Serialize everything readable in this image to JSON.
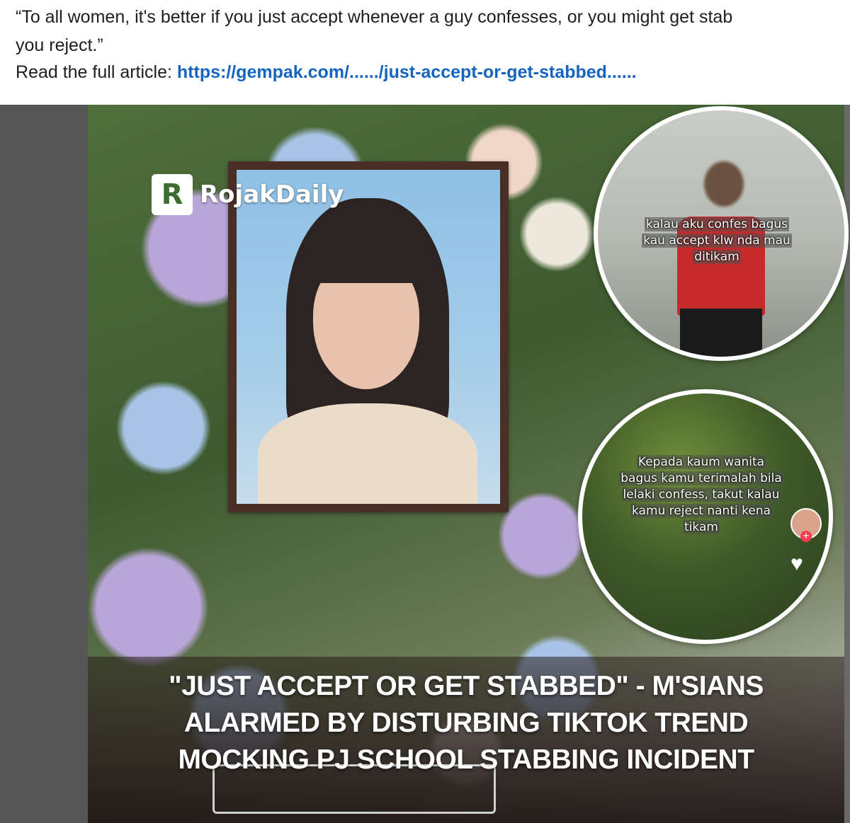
{
  "post": {
    "quote_line_1": "“To all women, it's better if you just accept whenever a guy confesses, or you might get stab",
    "quote_line_2": "you reject.”",
    "read_label": "Read the full article: ",
    "link_text": "https://gempak.com/....../just-accept-or-get-stabbed......"
  },
  "image": {
    "logo_mark": "R",
    "logo_text": "RojakDaily",
    "bubble_top_caption": [
      "kalau aku confes bagus",
      "kau accept klw nda mau",
      "ditikam"
    ],
    "bubble_bottom_caption": [
      "Kepada kaum wanita",
      "bagus kamu terimalah bila",
      "lelaki confess, takut kalau",
      "kamu reject nanti kena",
      "tikam"
    ],
    "avatar_plus": "+",
    "headline_lines": [
      "\"JUST ACCEPT OR GET STABBED\" - M'SIANS",
      "ALARMED BY DISTURBING TIKTOK TREND",
      "MOCKING PJ SCHOOL STABBING INCIDENT"
    ]
  },
  "icons": {
    "heart": "heart-icon",
    "avatar": "tiktok-avatar"
  },
  "colors": {
    "link": "#1565c0",
    "text": "#1c1e21"
  }
}
